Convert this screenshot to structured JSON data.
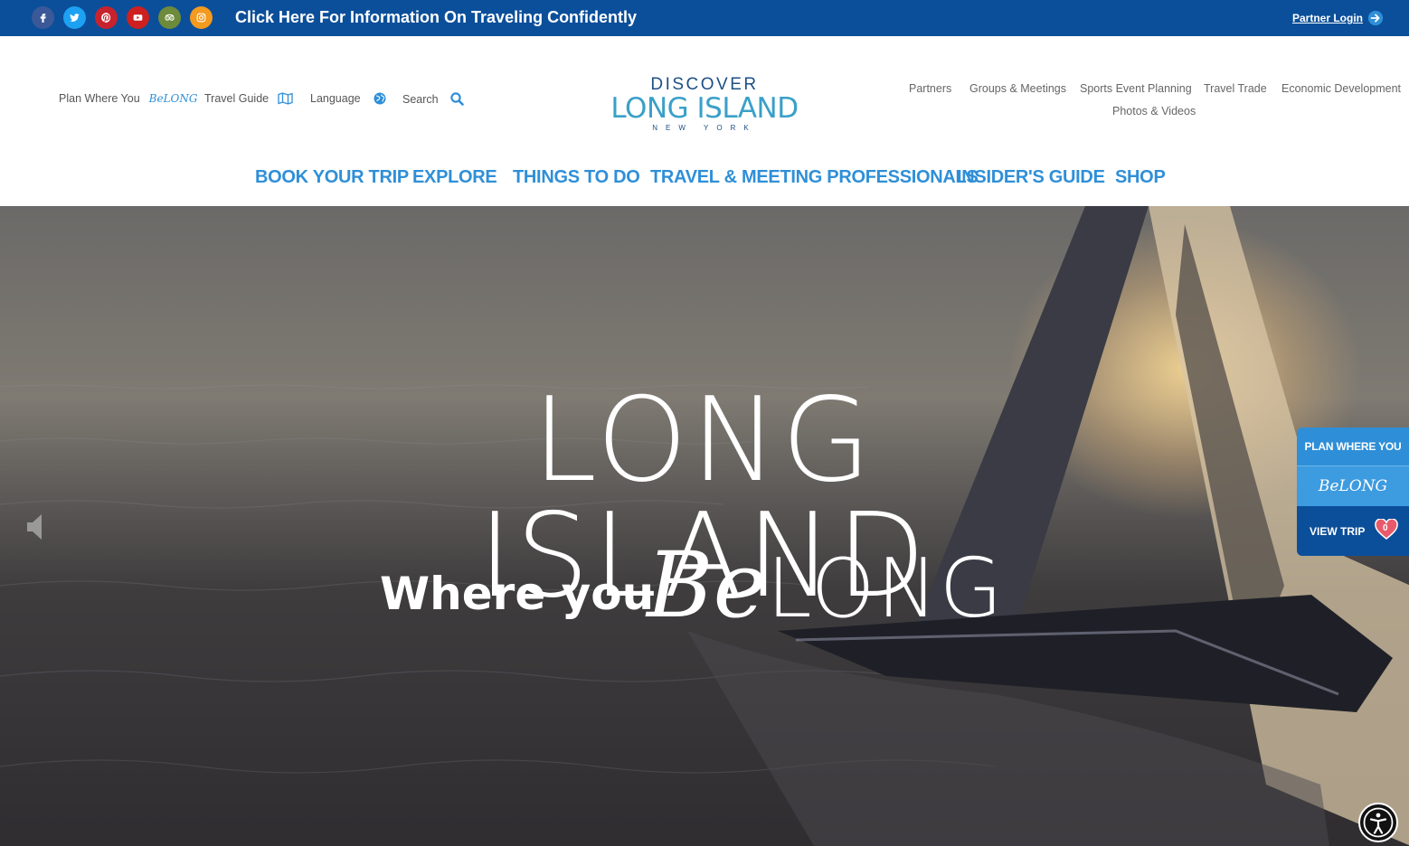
{
  "topbar": {
    "social": [
      "facebook-icon",
      "twitter-icon",
      "pinterest-icon",
      "youtube-icon",
      "tripadvisor-icon",
      "instagram-icon"
    ],
    "social_colors": [
      "#3b5998",
      "#1da1f2",
      "#c8232c",
      "#cd201f",
      "#6e8a3b",
      "#f39a1f"
    ],
    "banner_text": "Click Here For Information On Traveling Confidently",
    "partner_login": "Partner Login"
  },
  "header": {
    "utility": {
      "plan": "Plan Where You",
      "plan_logo": "BeLONG",
      "travel_guide": "Travel Guide",
      "language": "Language",
      "search": "Search"
    },
    "logo": {
      "line1": "DISCOVER",
      "line2": "LONG ISLAND",
      "line3": "NEW YORK"
    },
    "top_links": [
      "Partners",
      "Groups & Meetings",
      "Sports Event Planning",
      "Travel Trade",
      "Economic Development",
      "Photos & Videos"
    ],
    "main_nav": [
      "BOOK YOUR TRIP",
      "EXPLORE",
      "THINGS TO DO",
      "TRAVEL & MEETING PROFESSIONALS",
      "INSIDER'S GUIDE",
      "SHOP"
    ]
  },
  "hero": {
    "title": "LONG ISLAND",
    "subtitle": "Where you",
    "belong_be": "Be",
    "belong_long": "LONG"
  },
  "trip_widget": {
    "plan_label": "PLAN WHERE YOU",
    "logo_text": "BeLONG",
    "view_trip": "VIEW TRIP",
    "count": "0"
  },
  "colors": {
    "topbar": "#0b4f9a",
    "nav_blue": "#2f8fd8",
    "logo_teal": "#3aa0c8"
  }
}
